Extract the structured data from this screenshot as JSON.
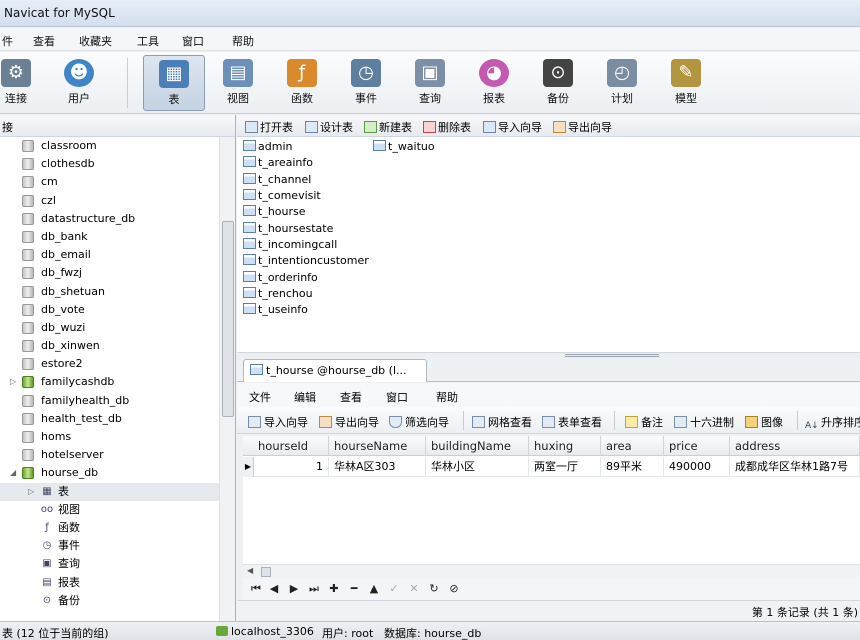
{
  "window": {
    "title": "Navicat for MySQL"
  },
  "menu": [
    "件",
    "查看",
    "收藏夹",
    "工具",
    "窗口",
    "帮助"
  ],
  "toolbar": [
    {
      "label": "连接",
      "icon": "connection-icon",
      "color": "#6b7f95"
    },
    {
      "label": "用户",
      "icon": "user-icon",
      "color": "#3f86c9"
    },
    {
      "label": "表",
      "icon": "table-icon",
      "color": "#4c7fb8",
      "active": true
    },
    {
      "label": "视图",
      "icon": "view-icon",
      "color": "#6c90b8"
    },
    {
      "label": "函数",
      "icon": "function-icon",
      "color": "#d98a2c"
    },
    {
      "label": "事件",
      "icon": "event-icon",
      "color": "#5e7f9d"
    },
    {
      "label": "查询",
      "icon": "query-icon",
      "color": "#7c8fa6"
    },
    {
      "label": "报表",
      "icon": "report-icon",
      "color": "#c35ab0"
    },
    {
      "label": "备份",
      "icon": "backup-icon",
      "color": "#444444"
    },
    {
      "label": "计划",
      "icon": "schedule-icon",
      "color": "#7a8da3"
    },
    {
      "label": "模型",
      "icon": "model-icon",
      "color": "#b39540"
    }
  ],
  "left": {
    "header": "接",
    "databases": [
      "classroom",
      "clothesdb",
      "cm",
      "czl",
      "datastructure_db",
      "db_bank",
      "db_email",
      "db_fwzj",
      "db_shetuan",
      "db_vote",
      "db_wuzi",
      "db_xinwen",
      "estore2",
      "familycashdb",
      "familyhealth_db",
      "health_test_db",
      "homs",
      "hotelserver",
      "hourse_db"
    ],
    "children": [
      "表",
      "视图",
      "函数",
      "事件",
      "查询",
      "报表",
      "备份"
    ]
  },
  "objtoolbar": [
    "打开表",
    "设计表",
    "新建表",
    "删除表",
    "导入向导",
    "导出向导"
  ],
  "tables": [
    "admin",
    "t_areainfo",
    "t_channel",
    "t_comevisit",
    "t_hourse",
    "t_hoursestate",
    "t_incomingcall",
    "t_intentioncustomer",
    "t_orderinfo",
    "t_renchou",
    "t_useinfo",
    "t_waituo"
  ],
  "tab": {
    "label": "t_hourse @hourse_db (l..."
  },
  "innermenu": [
    "文件",
    "编辑",
    "查看",
    "窗口",
    "帮助"
  ],
  "innertoolbar": [
    "导入向导",
    "导出向导",
    "筛选向导",
    "网格查看",
    "表单查看",
    "备注",
    "十六进制",
    "图像",
    "升序排序"
  ],
  "grid": {
    "columns": [
      "hourseId",
      "hourseName",
      "buildingName",
      "huxing",
      "area",
      "price",
      "address"
    ],
    "rows": [
      [
        "1",
        "华林A区303",
        "华林小区",
        "两室一厅",
        "89平米",
        "490000",
        "成都成华区华林1路7号"
      ]
    ]
  },
  "gridstatus": "第 1 条记录 (共 1 条)",
  "statusbar": {
    "left": "表 (12 位于当前的组)",
    "connection": "localhost_3306",
    "user": "用户: root",
    "database": "数据库: hourse_db"
  }
}
